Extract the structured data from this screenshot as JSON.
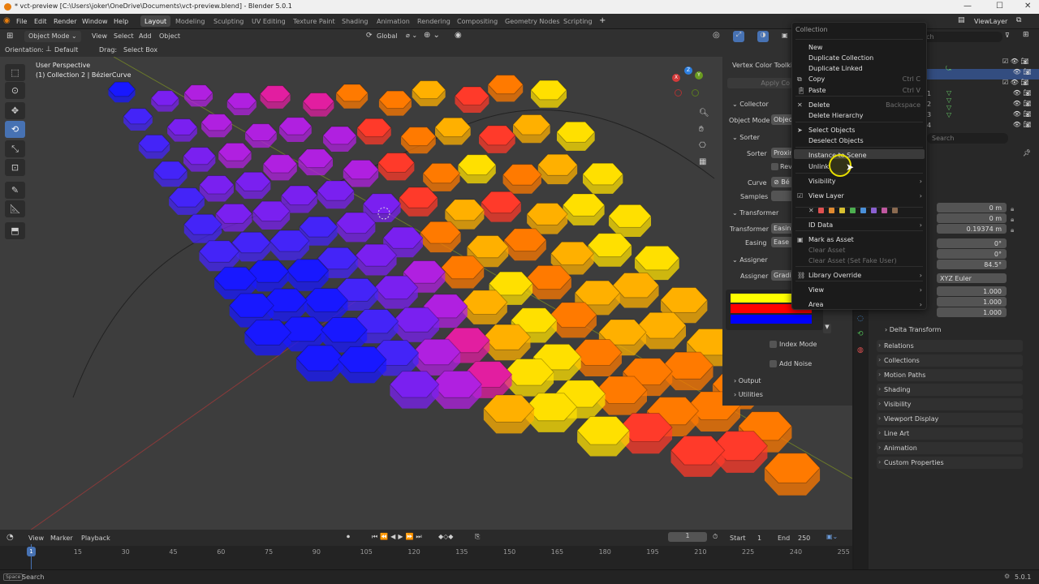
{
  "window": {
    "title": "* vct-preview [C:\\Users\\joker\\OneDrive\\Documents\\vct-preview.blend] - Blender 5.0.1"
  },
  "menubar": {
    "menus": [
      "File",
      "Edit",
      "Render",
      "Window",
      "Help"
    ],
    "workspaces": [
      "Layout",
      "Modeling",
      "Sculpting",
      "UV Editing",
      "Texture Paint",
      "Shading",
      "Animation",
      "Rendering",
      "Compositing",
      "Geometry Nodes",
      "Scripting"
    ],
    "active_workspace": "Layout",
    "view_layer": "ViewLayer"
  },
  "viewport_header": {
    "mode": "Object Mode",
    "menus": [
      "View",
      "Select",
      "Add",
      "Object"
    ],
    "transform_orientation": "Global",
    "orientation_label": "Orientation:",
    "orientation_value": "Default",
    "drag_label": "Drag:",
    "drag_value": "Select Box"
  },
  "viewport": {
    "perspective": "User Perspective",
    "active_object": "(1) Collection 2 | BézierCurve",
    "gizmo_axes": [
      "X",
      "Y",
      "Z"
    ],
    "hex_colors": [
      "#ffe000",
      "#ffb000",
      "#ff7a00",
      "#ff3a2a",
      "#ff2060",
      "#e21ea0",
      "#b020e0",
      "#7a20f0",
      "#4424f8",
      "#1818ff"
    ]
  },
  "npanel": {
    "addon_title": "Vertex Color Toolkit",
    "apply_button": "Apply Co",
    "collector_label": "Collector",
    "object_mode_label": "Object Mode",
    "object_mode_value": "Objec",
    "sorter_label": "Sorter",
    "sorter_field_label": "Sorter",
    "sorter_value": "Proxim",
    "reverse_label": "Rev",
    "curve_label": "Curve",
    "curve_value": "Bé",
    "samples_label": "Samples",
    "transformer_label": "Transformer",
    "transformer_field_label": "Transformer",
    "transformer_value": "Easin",
    "easing_label": "Easing",
    "easing_value": "Ease",
    "assigner_label": "Assigner",
    "assigner_field_label": "Assigner",
    "assigner_value": "Gradi",
    "gradient_colors": [
      "#ffff00",
      "#ff0000",
      "#0000ff"
    ],
    "index_mode_label": "Index Mode",
    "add_noise_label": "Add Noise",
    "output_label": "Output",
    "utilities_label": "Utilities"
  },
  "context_menu": {
    "title": "Collection",
    "items": [
      {
        "label": "New",
        "shortcut": "",
        "disabled": false,
        "icon": "",
        "submenu": false
      },
      {
        "label": "Duplicate Collection",
        "shortcut": "",
        "disabled": false,
        "icon": "",
        "submenu": false
      },
      {
        "label": "Duplicate Linked",
        "shortcut": "",
        "disabled": false,
        "icon": "",
        "submenu": false
      },
      {
        "label": "Copy",
        "shortcut": "Ctrl C",
        "disabled": false,
        "icon": "copy-icon",
        "submenu": false
      },
      {
        "label": "Paste",
        "shortcut": "Ctrl V",
        "disabled": false,
        "icon": "paste-icon",
        "submenu": false
      },
      {
        "label": "Delete",
        "shortcut": "Backspace",
        "disabled": false,
        "icon": "x-icon",
        "submenu": false
      },
      {
        "label": "Delete Hierarchy",
        "shortcut": "",
        "disabled": false,
        "icon": "",
        "submenu": false
      },
      {
        "label": "Select Objects",
        "shortcut": "",
        "disabled": false,
        "icon": "cursor-icon",
        "submenu": false
      },
      {
        "label": "Deselect Objects",
        "shortcut": "",
        "disabled": false,
        "icon": "",
        "submenu": false
      },
      {
        "label": "Instance to Scene",
        "shortcut": "",
        "disabled": false,
        "icon": "",
        "submenu": false
      },
      {
        "label": "Unlink",
        "shortcut": "",
        "disabled": false,
        "icon": "",
        "submenu": false
      },
      {
        "label": "Visibility",
        "shortcut": "",
        "disabled": false,
        "icon": "",
        "submenu": true
      },
      {
        "label": "View Layer",
        "shortcut": "",
        "disabled": false,
        "icon": "checkbox-icon",
        "submenu": true
      },
      {
        "label": "ID Data",
        "shortcut": "",
        "disabled": false,
        "icon": "",
        "submenu": true
      },
      {
        "label": "Mark as Asset",
        "shortcut": "",
        "disabled": false,
        "icon": "asset-icon",
        "submenu": false
      },
      {
        "label": "Clear Asset",
        "shortcut": "",
        "disabled": true,
        "icon": "",
        "submenu": false
      },
      {
        "label": "Clear Asset (Set Fake User)",
        "shortcut": "",
        "disabled": true,
        "icon": "",
        "submenu": false
      },
      {
        "label": "Library Override",
        "shortcut": "",
        "disabled": false,
        "icon": "override-icon",
        "submenu": true
      },
      {
        "label": "View",
        "shortcut": "",
        "disabled": false,
        "icon": "",
        "submenu": true
      },
      {
        "label": "Area",
        "shortcut": "",
        "disabled": false,
        "icon": "",
        "submenu": true
      }
    ],
    "color_tags": [
      "#e05050",
      "#e08a30",
      "#d8c030",
      "#4caf50",
      "#4a90d9",
      "#8a60d0",
      "#c058a0",
      "#8a6a50"
    ],
    "hovered_item": "Instance to Scene"
  },
  "outliner": {
    "search_placeholder": "rch",
    "row_labels": [
      "1",
      "2",
      "3",
      "4"
    ]
  },
  "properties": {
    "search_placeholder": "Search",
    "location": [
      "0 m",
      "0 m",
      "0.19374 m"
    ],
    "rotation": [
      "0°",
      "0°",
      "84.5°"
    ],
    "rotation_mode": "XYZ Euler",
    "scale": [
      "1.000",
      "1.000",
      "1.000"
    ],
    "delta_transform": "Delta Transform",
    "panels": [
      "Relations",
      "Collections",
      "Motion Paths",
      "Shading",
      "Visibility",
      "Viewport Display",
      "Line Art",
      "Animation",
      "Custom Properties"
    ]
  },
  "timeline": {
    "menus": [
      "View",
      "Marker",
      "Playback"
    ],
    "current_frame": "1",
    "start_label": "Start",
    "start": "1",
    "end_label": "End",
    "end": "250",
    "ticks": [
      "1",
      "15",
      "30",
      "45",
      "60",
      "75",
      "90",
      "105",
      "120",
      "135",
      "150",
      "165",
      "180",
      "195",
      "210",
      "225",
      "240",
      "255"
    ]
  },
  "statusbar": {
    "key": "Space",
    "action": "Search",
    "version": "5.0.1"
  }
}
